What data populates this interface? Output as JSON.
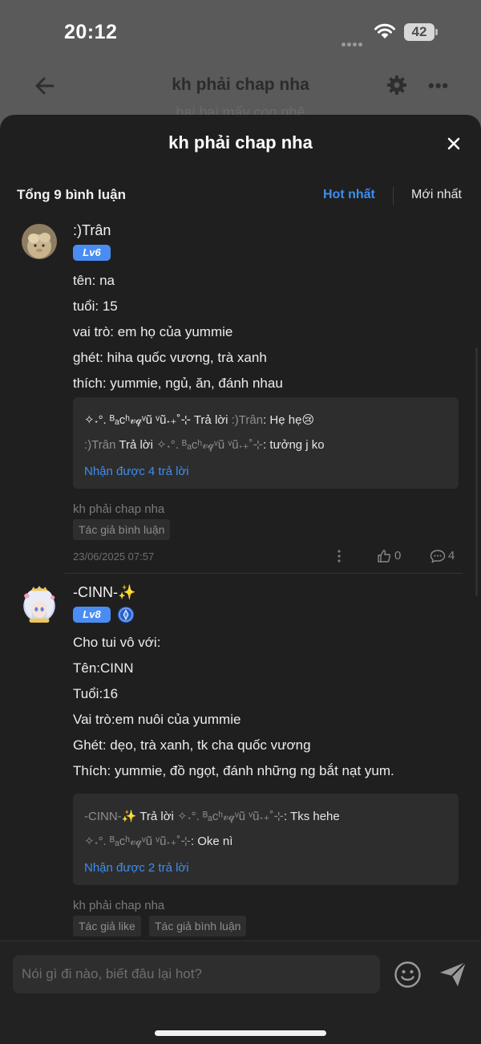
{
  "status_bar": {
    "time": "20:12",
    "battery": "42"
  },
  "background": {
    "title": "kh phải chap nha",
    "sliver_text": "bai bai mấy con ghệ"
  },
  "sheet": {
    "title": "kh phải chap nha",
    "comment_count": "Tổng 9 bình luận",
    "sort_hot": "Hot nhất",
    "sort_new": "Mới nhất"
  },
  "comments": [
    {
      "name": ":)Trân",
      "level": "Lv6",
      "lines": [
        "tên: na",
        "tuổi: 15",
        "vai trò: em họ của yummie",
        "ghét: hiha quốc vương, trà xanh",
        "thích: yummie, ngủ, ăn, đánh nhau"
      ],
      "replies": [
        {
          "from": "✧˖°. ᴮₐcʰ𝓋𝓆ᵛũ ᵛũ˖₊˚⊹",
          "verb": "Trả lời",
          "to": ":)Trân",
          "text": ": Hẹ hẹ😢"
        },
        {
          "from": ":)Trân",
          "verb": "Trả lời",
          "to": "✧˖°. ᴮₐcʰ𝓋𝓆ᵛũ ᵛũ˖₊˚⊹",
          "text": ": tưởng j ko"
        }
      ],
      "more_replies": "Nhận được 4 trả lời",
      "source": "kh phải chap nha",
      "tags": [
        "Tác giả bình luận"
      ],
      "date": "23/06/2025 07:57",
      "likes": "0",
      "reply_count": "4"
    },
    {
      "name": "-CINN-✨",
      "level": "Lv8",
      "lines": [
        "Cho tui vô với:",
        "Tên:CINN",
        "Tuổi:16",
        "Vai trò:em nuôi của yummie",
        "Ghét: dẹo, trà xanh, tk cha quốc vương",
        "Thích: yummie, đồ ngọt, đánh những ng bắt nạt yum."
      ],
      "replies": [
        {
          "from": "-CINN-✨",
          "verb": "Trả lời",
          "to": "✧˖°. ᴮₐcʰ𝓋𝓆ᵛũ ᵛũ˖₊˚⊹",
          "text": ": Tks hehe"
        },
        {
          "from": "✧˖°. ᴮₐcʰ𝓋𝓆ᵛũ ᵛũ˖₊˚⊹",
          "verb": "",
          "to": "",
          "text": ": Oke nì"
        }
      ],
      "more_replies": "Nhận được 2 trả lời",
      "source": "kh phải chap nha",
      "tags": [
        "Tác giả like",
        "Tác giả bình luận"
      ]
    }
  ],
  "input": {
    "placeholder": "Nói gì đi nào, biết đâu lại hot?"
  },
  "colors": {
    "accent": "#3d8ef0",
    "sheet_bg": "#1f1f1f",
    "reply_bg": "#2d2d2d"
  }
}
